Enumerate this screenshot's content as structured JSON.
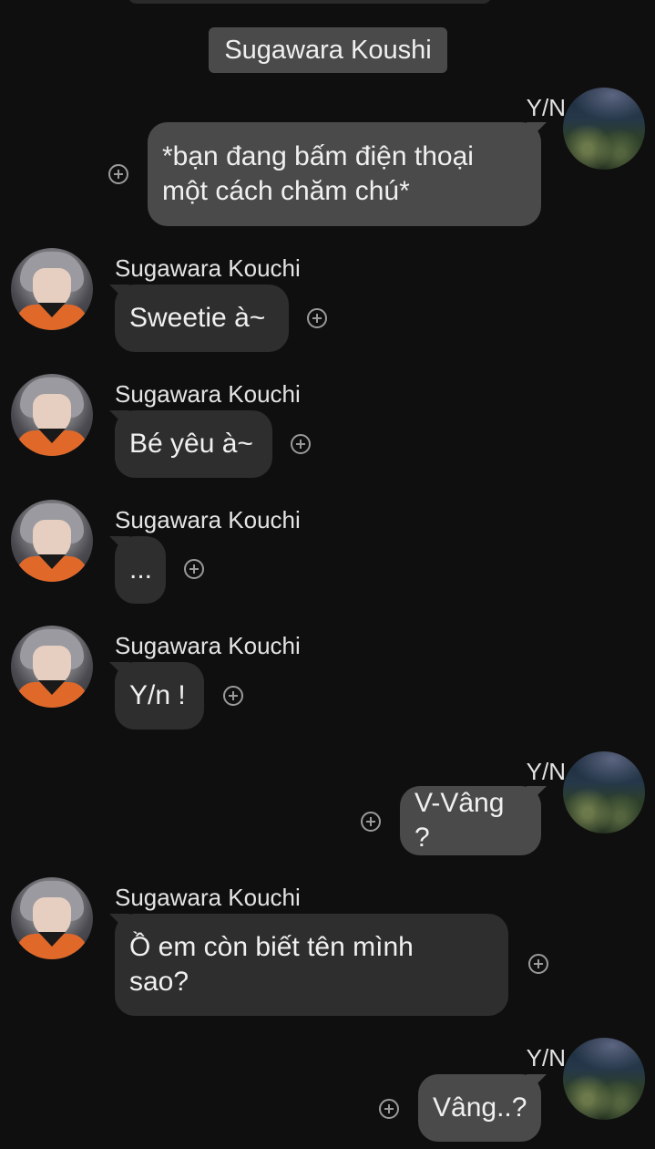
{
  "chat": {
    "title": "Sugawara Koushi"
  },
  "messages": [
    {
      "sender": "Y/N",
      "side": "out",
      "text": "*bạn đang bấm điện thoại\nmột cách chăm chú*"
    },
    {
      "sender": "Sugawara Kouchi",
      "side": "in",
      "text": "Sweetie à~"
    },
    {
      "sender": "Sugawara Kouchi",
      "side": "in",
      "text": "Bé yêu à~"
    },
    {
      "sender": "Sugawara Kouchi",
      "side": "in",
      "text": "..."
    },
    {
      "sender": "Sugawara Kouchi",
      "side": "in",
      "text": "Y/n !"
    },
    {
      "sender": "Y/N",
      "side": "out",
      "text": "V-Vâng ?"
    },
    {
      "sender": "Sugawara Kouchi",
      "side": "in",
      "text": "Ồ em còn biết tên mình\nsao?"
    },
    {
      "sender": "Y/N",
      "side": "out",
      "text": "Vâng..?"
    }
  ],
  "icons": {
    "react": "plus-circle-icon",
    "avatar_user": "night-field-avatar",
    "avatar_suga": "character-avatar"
  },
  "colors": {
    "background": "#0f0f0f",
    "bubble_in": "#2e2e2e",
    "bubble_out": "#4a4a4a",
    "title_bg": "#4a4a4a"
  }
}
